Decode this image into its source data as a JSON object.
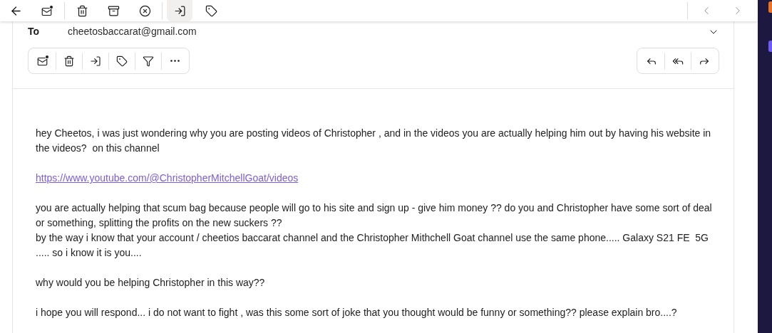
{
  "top_toolbar": {
    "groups": [
      [
        {
          "kind": "back",
          "selected": false
        },
        {
          "kind": "mark-unread",
          "selected": false
        }
      ],
      [
        {
          "kind": "delete",
          "selected": false
        },
        {
          "kind": "archive",
          "selected": false
        },
        {
          "kind": "spam",
          "selected": false
        }
      ],
      [
        {
          "kind": "move",
          "selected": true
        },
        {
          "kind": "label",
          "selected": false
        }
      ]
    ],
    "nav": [
      {
        "kind": "previous"
      },
      {
        "kind": "next"
      }
    ]
  },
  "header": {
    "to_label": "To",
    "to_address": "cheetosbaccarat@gmail.com"
  },
  "message_actions": [
    {
      "kind": "mark-unread"
    },
    {
      "kind": "delete"
    },
    {
      "kind": "move"
    },
    {
      "kind": "label"
    },
    {
      "kind": "filter"
    },
    {
      "kind": "more"
    }
  ],
  "reply_actions": [
    {
      "kind": "reply"
    },
    {
      "kind": "reply-all"
    },
    {
      "kind": "forward"
    }
  ],
  "body": [
    {
      "kind": "text",
      "lines": [
        "hey Cheetos, i was just wondering why you are posting videos of Christopher , and in the videos you are actually helping him out by having his website in the videos?  on this channel"
      ]
    },
    {
      "kind": "link",
      "lines": [
        "https://www.youtube.com/@ChristopherMitchellGoat/videos"
      ]
    },
    {
      "kind": "text",
      "lines": [
        "you are actually helping that scum bag because people will go to his site and sign up - give him money ?? do you and Christopher have some sort of deal or something, splitting the profits on the new suckers ??",
        "by the way i know that your account / cheetios baccarat channel and the Christopher Mithchell Goat channel use the same phone..... Galaxy S21 FE  5G ..... so i know it is you...."
      ]
    },
    {
      "kind": "text",
      "lines": [
        "why would you be helping Christopher in this way??"
      ]
    },
    {
      "kind": "text",
      "lines": [
        "i hope you will respond... i do not want to fight , was this some sort of joke that you thought would be funny or something?? please explain bro....?"
      ]
    }
  ]
}
